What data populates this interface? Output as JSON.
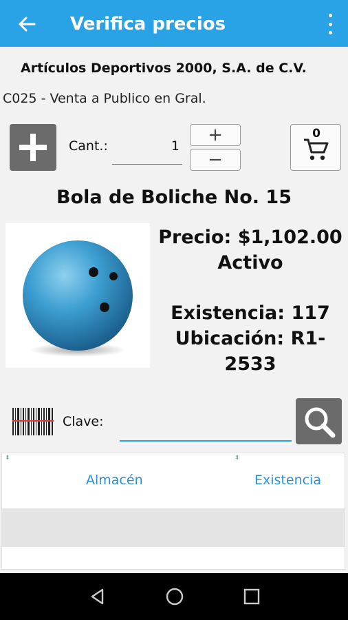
{
  "app_bar": {
    "title": "Verifica precios",
    "back_icon": "arrow-left-icon",
    "menu_icon": "more-vert-icon",
    "color": "#29a3e6"
  },
  "company_name": "Artículos Deportivos 2000, S.A. de C.V.",
  "price_list": "C025 - Venta a Publico en Gral.",
  "quantity": {
    "label": "Cant.:",
    "value": "1",
    "plus_label": "+",
    "minus_label": "−"
  },
  "cart": {
    "count": "0",
    "icon": "shopping-cart-icon"
  },
  "product": {
    "name": "Bola de Boliche No. 15",
    "price_line": "Precio: $1,102.00",
    "status": "Activo",
    "stock_line": "Existencia: 117",
    "location_line": "Ubicación: R1-2533",
    "image_icon": "bowling-ball-image"
  },
  "search": {
    "label": "Clave:",
    "value": "",
    "placeholder": ""
  },
  "table": {
    "columns": [
      "Almacén",
      "Existencia"
    ]
  },
  "nav": {
    "back": "nav-back-icon",
    "home": "nav-home-icon",
    "recents": "nav-recents-icon"
  }
}
